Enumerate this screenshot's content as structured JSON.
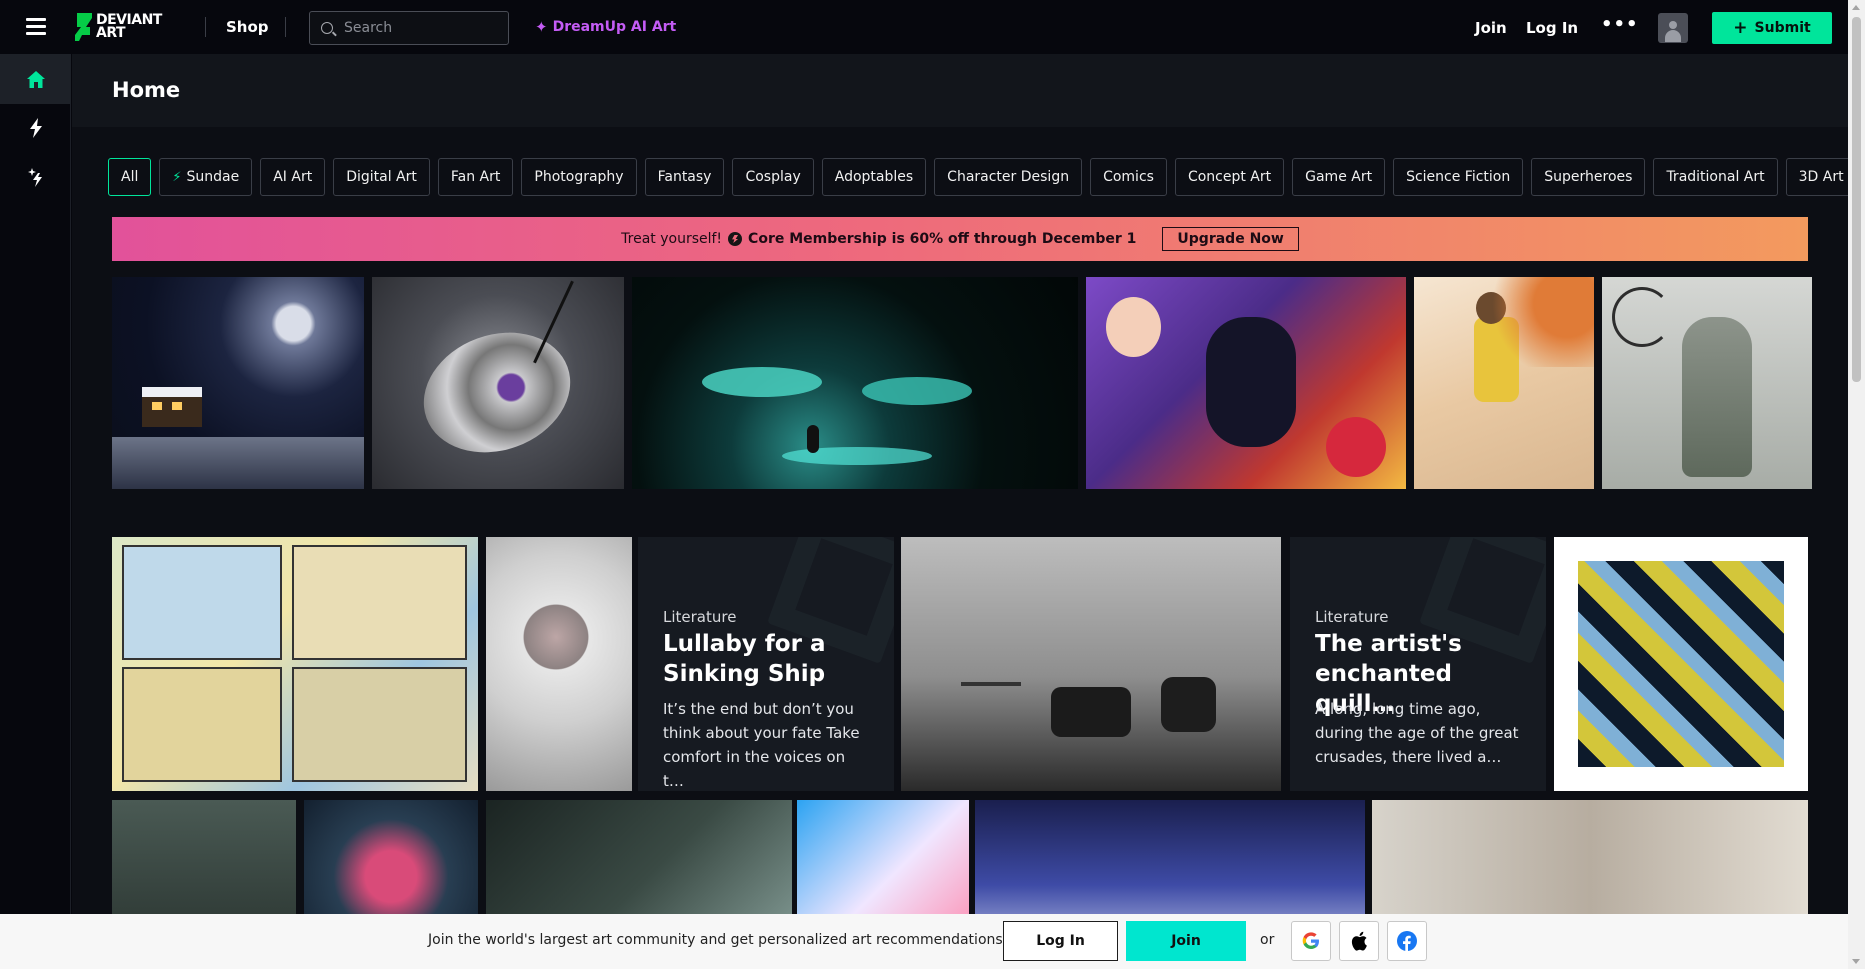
{
  "topbar": {
    "logo_line1": "DEVIANT",
    "logo_line2": "ART",
    "shop": "Shop",
    "search_placeholder": "Search",
    "dreamup": "DreamUp AI Art",
    "join": "Join",
    "login": "Log In",
    "more": "•••",
    "submit": "Submit"
  },
  "rail": {
    "items": [
      "home-icon",
      "bolt-icon",
      "dreamup-icon"
    ]
  },
  "page": {
    "title": "Home"
  },
  "chips": [
    "All",
    "Sundae",
    "AI Art",
    "Digital Art",
    "Fan Art",
    "Photography",
    "Fantasy",
    "Cosplay",
    "Adoptables",
    "Character Design",
    "Comics",
    "Concept Art",
    "Game Art",
    "Science Fiction",
    "Superheroes",
    "Traditional Art",
    "3D Art"
  ],
  "promo": {
    "treat": "Treat yourself!",
    "deal": "Core Membership is 60% off through December 1",
    "button": "Upgrade Now",
    "colors": {
      "start": "#e2529a",
      "end": "#f39a5e"
    }
  },
  "literature": [
    {
      "category": "Literature",
      "title": "Lullaby for a Sinking Ship",
      "excerpt": "It’s the end but don’t you think about your fate Take comfort in the voices on t…"
    },
    {
      "category": "Literature",
      "title": "The artist's enchanted quill…",
      "excerpt": "A long, long time ago, during the age of the great crusades, there lived a…"
    }
  ],
  "joinbar": {
    "message": "Join the world's largest art community and get personalized art recommendations.",
    "login": "Log In",
    "join": "Join",
    "or": "or"
  },
  "colors": {
    "accent": "#00e59b",
    "dreamup": "#c45cf5",
    "background": "#06070d"
  }
}
